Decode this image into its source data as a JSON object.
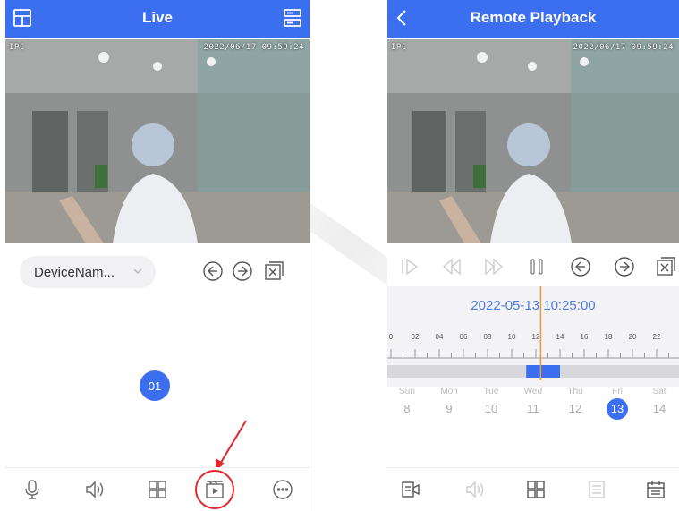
{
  "live": {
    "title": "Live",
    "osd_channel": "IPC",
    "osd_timestamp": "2022/06/17 09:59:24",
    "device_select": "DeviceNam...",
    "window_badge": "01",
    "top_controls": [
      "arrow-left-circle-icon",
      "arrow-right-circle-icon",
      "close-window-icon"
    ],
    "bottom_toolbar": [
      "microphone-icon",
      "speaker-icon",
      "grid-icon",
      "playback-icon",
      "more-icon"
    ],
    "highlight_color": "#e0262e"
  },
  "playback": {
    "title": "Remote Playback",
    "osd_channel": "IPC",
    "osd_timestamp": "2022/06/17 09:59:24",
    "date_time": "2022-05-13 10:25:00",
    "timeline_labels": [
      "0",
      "02",
      "04",
      "06",
      "08",
      "10",
      "12",
      "14",
      "16",
      "18",
      "20",
      "22"
    ],
    "recorded_segment": {
      "start_hour": 11.2,
      "end_hour": 14.0
    },
    "current_hour": 12.4,
    "days": [
      {
        "name": "Sun",
        "date": "8"
      },
      {
        "name": "Mon",
        "date": "9"
      },
      {
        "name": "Tue",
        "date": "10"
      },
      {
        "name": "Wed",
        "date": "11"
      },
      {
        "name": "Thu",
        "date": "12"
      },
      {
        "name": "Fri",
        "date": "13"
      },
      {
        "name": "Sat",
        "date": "14"
      }
    ],
    "selected_day_index": 5,
    "controls": [
      "step-play-icon",
      "rewind-icon",
      "fast-forward-icon",
      "pause-icon",
      "arrow-left-circle-icon",
      "arrow-right-circle-icon",
      "close-window-icon"
    ],
    "bottom_toolbar": [
      "record-icon",
      "speaker-icon",
      "grid-icon",
      "list-icon",
      "calendar-icon"
    ]
  },
  "colors": {
    "accent": "#3c6ff0",
    "timeline_cursor": "#f29a2e"
  }
}
